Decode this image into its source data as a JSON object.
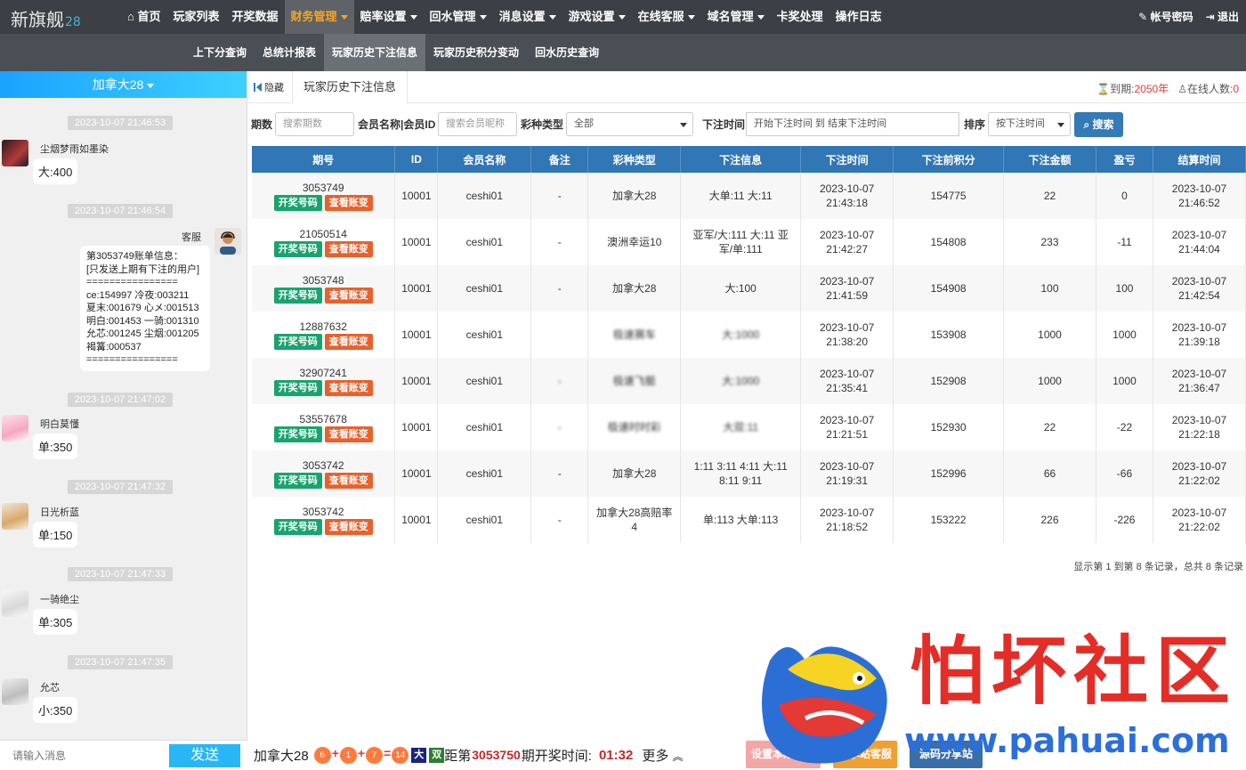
{
  "brand": {
    "name": "新旗舰",
    "suffix": "28"
  },
  "nav": {
    "items": [
      {
        "label": "首页",
        "icon": "home-icon",
        "caret": false
      },
      {
        "label": "玩家列表",
        "caret": false
      },
      {
        "label": "开奖数据",
        "caret": false
      },
      {
        "label": "财务管理",
        "caret": true,
        "active": true
      },
      {
        "label": "赔率设置",
        "caret": true
      },
      {
        "label": "回水管理",
        "caret": true
      },
      {
        "label": "消息设置",
        "caret": true
      },
      {
        "label": "游戏设置",
        "caret": true
      },
      {
        "label": "在线客服",
        "caret": true
      },
      {
        "label": "域名管理",
        "caret": true
      },
      {
        "label": "卡奖处理",
        "caret": false
      },
      {
        "label": "操作日志",
        "caret": false
      }
    ],
    "account_label": "帐号密码",
    "logout_label": "退出"
  },
  "subnav": {
    "items": [
      "上下分查询",
      "总统计报表",
      "玩家历史下注信息",
      "玩家历史积分变动",
      "回水历史查询"
    ],
    "active_index": 2
  },
  "chat": {
    "room": "加拿大28",
    "messages": [
      {
        "time": "2023-10-07 21:46:53",
        "user": "尘烟梦雨如墨染",
        "text": "大:400"
      },
      {
        "time": "2023-10-07 21:46:54",
        "user": "客服",
        "text": "第3053749账单信息：\n[只发送上期有下注的用户]\n================\nce:154997 冷夜:003211\n夏末:001679 心メ:001513\n明白:001453 一骑:001310\n允芯:001245 尘烟:001205\n褐篝:000537\n================"
      },
      {
        "time": "2023-10-07 21:47:02",
        "user": "明白莫懂",
        "text": "单:350"
      },
      {
        "time": "2023-10-07 21:47:32",
        "user": "日光析蓝",
        "text": "单:150"
      },
      {
        "time": "2023-10-07 21:47:33",
        "user": "一骑绝尘",
        "text": "单:305"
      },
      {
        "time": "2023-10-07 21:47:35",
        "user": "允芯",
        "text": "小:350"
      }
    ],
    "input_placeholder": "请输入消息",
    "send_label": "发送"
  },
  "main": {
    "hide_label": "隐藏",
    "tab_label": "玩家历史下注信息",
    "expire_label": "到期:",
    "expire_value": "2050年",
    "online_label": "在线人数:",
    "online_value": "0"
  },
  "filters": {
    "period_label": "期数",
    "period_placeholder": "搜索期数",
    "member_label": "会员名称|会员ID",
    "member_placeholder": "搜索会员昵称",
    "lottery_label": "彩种类型",
    "lottery_value": "全部",
    "time_label": "下注时间",
    "time_placeholder": "开始下注时间 到 结束下注时间",
    "sort_label": "排序",
    "sort_value": "按下注时间",
    "search_label": "搜索"
  },
  "table": {
    "headers": [
      "期号",
      "ID",
      "会员名称",
      "备注",
      "彩种类型",
      "下注信息",
      "下注时间",
      "下注前积分",
      "下注金额",
      "盈亏",
      "结算时间"
    ],
    "btn_draw": "开奖号码",
    "btn_account": "查看账变",
    "rows": [
      {
        "period": "3053749",
        "id": "10001",
        "member": "ceshi01",
        "note": "-",
        "lottery": "加拿大28",
        "bet": "大单:11 大:11",
        "bet_time": "2023-10-07 21:43:18",
        "before": "154775",
        "amount": "22",
        "pl": "0",
        "settle": "2023-10-07 21:46:52",
        "blur": false
      },
      {
        "period": "21050514",
        "id": "10001",
        "member": "ceshi01",
        "note": "-",
        "lottery": "澳洲幸运10",
        "bet": "亚军/大:111 大:11 亚军/单:111",
        "bet_time": "2023-10-07 21:42:27",
        "before": "154808",
        "amount": "233",
        "pl": "-11",
        "settle": "2023-10-07 21:44:04",
        "blur": false
      },
      {
        "period": "3053748",
        "id": "10001",
        "member": "ceshi01",
        "note": "-",
        "lottery": "加拿大28",
        "bet": "大:100",
        "bet_time": "2023-10-07 21:41:59",
        "before": "154908",
        "amount": "100",
        "pl": "100",
        "settle": "2023-10-07 21:42:54",
        "blur": false
      },
      {
        "period": "12887632",
        "id": "10001",
        "member": "ceshi01",
        "note": "",
        "lottery": "极速赛车",
        "bet": "大:1000",
        "bet_time": "2023-10-07 21:38:20",
        "before": "153908",
        "amount": "1000",
        "pl": "1000",
        "settle": "2023-10-07 21:39:18",
        "blur": true
      },
      {
        "period": "32907241",
        "id": "10001",
        "member": "ceshi01",
        "note": "-",
        "lottery": "极速飞艇",
        "bet": "大:1000",
        "bet_time": "2023-10-07 21:35:41",
        "before": "152908",
        "amount": "1000",
        "pl": "1000",
        "settle": "2023-10-07 21:36:47",
        "blur": true
      },
      {
        "period": "53557678",
        "id": "10001",
        "member": "ceshi01",
        "note": "-",
        "lottery": "极速时时彩",
        "bet": "大双:11",
        "bet_time": "2023-10-07 21:21:51",
        "before": "152930",
        "amount": "22",
        "pl": "-22",
        "settle": "2023-10-07 21:22:18",
        "blur": true
      },
      {
        "period": "3053742",
        "id": "10001",
        "member": "ceshi01",
        "note": "-",
        "lottery": "加拿大28",
        "bet": "1:11 3:11 4:11 大:11 8:11 9:11",
        "bet_time": "2023-10-07 21:19:31",
        "before": "152996",
        "amount": "66",
        "pl": "-66",
        "settle": "2023-10-07 21:22:02",
        "blur": false
      },
      {
        "period": "3053742",
        "id": "10001",
        "member": "ceshi01",
        "note": "-",
        "lottery": "加拿大28高赔率4",
        "bet": "单:113 大单:113",
        "bet_time": "2023-10-07 21:18:52",
        "before": "153222",
        "amount": "226",
        "pl": "-226",
        "settle": "2023-10-07 21:22:02",
        "blur": false
      }
    ],
    "pageinfo": "显示第 1 到第 8 条记录，总共 8 条记录"
  },
  "lottery_bar": {
    "name": "加拿大28",
    "balls": [
      "6",
      "1",
      "7",
      "14"
    ],
    "size_tag": "大",
    "parity_tag": "双",
    "next_prefix": "距第",
    "next_period": "3053750",
    "next_suffix": "期开奖时间:",
    "countdown": "01:32",
    "more_label": "更多"
  },
  "bottom_buttons": [
    "设置本期无效",
    "分享站客服",
    "源码分享站"
  ],
  "watermark": {
    "text": "怕坏社区",
    "url": "www.pahuai.com"
  },
  "colors": {
    "nav_bg": "#3c3f45",
    "active_nav_text": "#f5a623",
    "table_header": "#3176b5",
    "btn_green": "#1aa36f",
    "btn_red": "#e8612c",
    "chat_header": "#1aa3ff",
    "watermark_red": "#e52d27",
    "watermark_blue": "#2a6fdb"
  }
}
